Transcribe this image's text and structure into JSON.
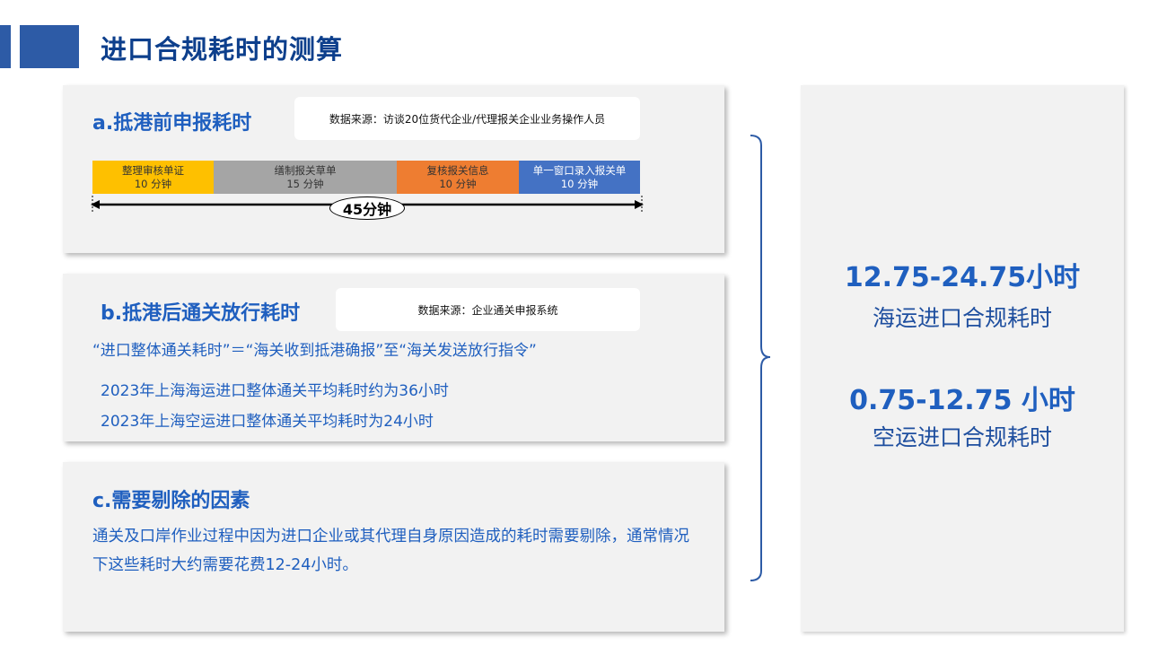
{
  "header": {
    "title": "进口合规耗时的测算"
  },
  "section_a": {
    "title": "a.抵港前申报耗时",
    "source": "数据来源：访谈20位货代企业/代理报关企业业务操作人员",
    "steps": [
      {
        "name": "整理审核单证",
        "time": "10 分钟",
        "color": "#fec000"
      },
      {
        "name": "缮制报关草单",
        "time": "15 分钟",
        "color": "#a5a5a5"
      },
      {
        "name": "复核报关信息",
        "time": "10 分钟",
        "color": "#ee7d31"
      },
      {
        "name": "单一窗口录入报关单",
        "time": "10 分钟",
        "color": "#4472c4"
      }
    ],
    "total": "45分钟"
  },
  "section_b": {
    "title": "b.抵港后通关放行耗时",
    "source": "数据来源：企业通关申报系统",
    "formula": "“进口整体通关耗时”＝“海关收到抵港确报”至“海关发送放行指令”",
    "line1": "2023年上海海运进口整体通关平均耗时约为36小时",
    "line2": "2023年上海空运进口整体通关平均耗时为24小时"
  },
  "section_c": {
    "title": "c.需要剔除的因素",
    "body": "通关及口岸作业过程中因为进口企业或其代理自身原因造成的耗时需要剔除，通常情况下这些耗时大约需要花费12-24小时。"
  },
  "summary": {
    "sea_value": "12.75-24.75小时",
    "sea_label": "海运进口合规耗时",
    "air_value": "0.75-12.75 小时",
    "air_label": "空运进口合规耗时"
  },
  "colors": {
    "accent": "#1f5fbf",
    "header_bar": "#2d5ba6",
    "panel_bg": "#f2f2f2"
  }
}
